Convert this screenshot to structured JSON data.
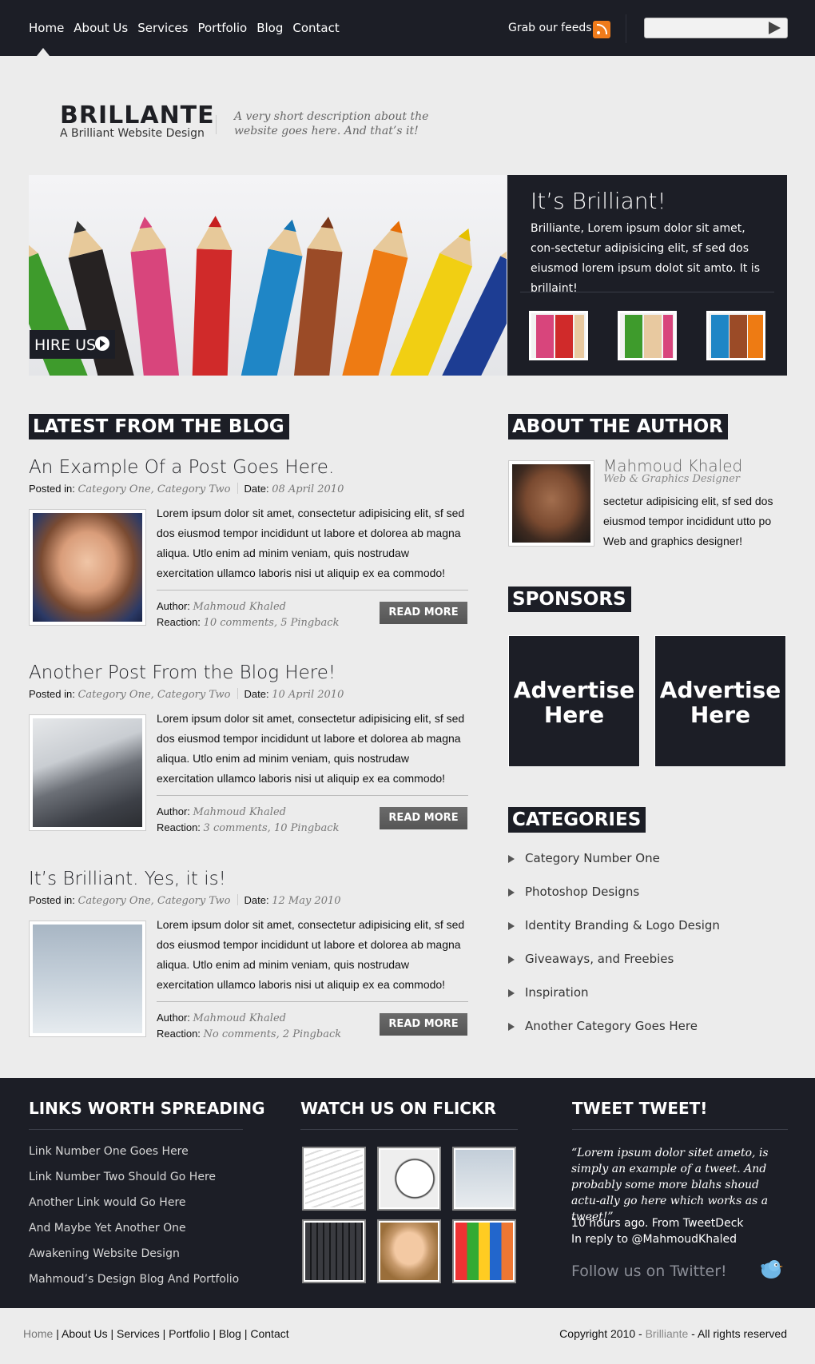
{
  "nav": {
    "items": [
      {
        "label": "Home"
      },
      {
        "label": "About Us"
      },
      {
        "label": "Services"
      },
      {
        "label": "Portfolio"
      },
      {
        "label": "Blog"
      },
      {
        "label": "Contact"
      }
    ],
    "feeds_label": "Grab our feeds",
    "search_placeholder": ""
  },
  "header": {
    "logo": "BRILLANTE",
    "logo_sub": "A Brilliant Website Design",
    "tagline": "A very short description about the website goes here. And that’s it!"
  },
  "hero": {
    "hire_label": "HIRE US",
    "side_title": "It’s Brilliant!",
    "side_text": "Brilliante, Lorem ipsum dolor sit amet, con-sectetur adipisicing elit, sf sed dos eiusmod lorem ipsum dolot sit amto. It is brillaint!"
  },
  "blog": {
    "heading": "LATEST FROM THE BLOG",
    "posted_in_label": "Posted in:",
    "date_label": "Date:",
    "author_label": "Author:",
    "reaction_label": "Reaction:",
    "readmore_label": "READ MORE",
    "posts": [
      {
        "title": "An Example Of a Post Goes Here.",
        "categories": "Category One, Category Two",
        "date": "08 April 2010",
        "body": "Lorem ipsum dolor sit amet, consectetur adipisicing elit, sf sed dos eiusmod tempor incididunt ut labore et dolorea ab magna aliqua. Utlo enim ad minim veniam, quis nostrudaw exercitation ullamco laboris nisi ut aliquip ex ea commodo!",
        "author": "Mahmoud Khaled",
        "reaction": "10 comments, 5 Pingback"
      },
      {
        "title": "Another Post From the Blog Here!",
        "categories": "Category One, Category Two",
        "date": "10 April 2010",
        "body": "Lorem ipsum dolor sit amet, consectetur adipisicing elit, sf sed dos eiusmod tempor incididunt ut labore et dolorea ab magna aliqua. Utlo enim ad minim veniam, quis nostrudaw exercitation ullamco laboris nisi ut aliquip ex ea commodo!",
        "author": "Mahmoud Khaled",
        "reaction": "3 comments, 10 Pingback"
      },
      {
        "title": "It’s Brilliant. Yes, it is!",
        "categories": "Category One, Category Two",
        "date": "12 May 2010",
        "body": "Lorem ipsum dolor sit amet, consectetur adipisicing elit, sf sed dos eiusmod tempor incididunt ut labore et dolorea ab magna aliqua. Utlo enim ad minim veniam, quis nostrudaw exercitation ullamco laboris nisi ut aliquip ex ea commodo!",
        "author": "Mahmoud Khaled",
        "reaction": "No comments, 2 Pingback"
      }
    ]
  },
  "author": {
    "heading": "ABOUT THE AUTHOR",
    "name": "Mahmoud Khaled",
    "role": "Web & Graphics Designer",
    "bio": "sectetur adipisicing elit, sf sed dos eiusmod tempor incididunt utto po Web and graphics designer!"
  },
  "sponsors": {
    "heading": "SPONSORS",
    "ad1": "Advertise Here",
    "ad2": "Advertise Here"
  },
  "categories": {
    "heading": "CATEGORIES",
    "items": [
      "Category Number One",
      "Photoshop Designs",
      "Identity Branding & Logo Design",
      "Giveaways, and Freebies",
      "Inspiration",
      "Another Category Goes Here"
    ]
  },
  "footer": {
    "links_heading": "LINKS WORTH SPREADING",
    "links": [
      "Link Number One Goes Here",
      "Link Number Two Should Go Here",
      "Another Link would Go Here",
      "And Maybe Yet Another One",
      "Awakening Website Design",
      "Mahmoud’s Design Blog And Portfolio"
    ],
    "flickr_heading": "WATCH US ON FLICKR",
    "tweet_heading": "TWEET TWEET!",
    "tweet_text": "“Lorem ipsum dolor sitet ameto, is simply an example of a tweet. And probably some more blahs shoud actu-ally go here which works as a tweet!”",
    "tweet_time": "10 hours ago. From TweetDeck",
    "tweet_reply": "In reply to @MahmoudKhaled",
    "follow_label": "Follow us on Twitter!"
  },
  "bottom": {
    "nav": [
      "Home",
      "About Us",
      "Services",
      "Portfolio",
      "Blog",
      "Contact"
    ],
    "copyright_pre": "Copyright 2010 - ",
    "copyright_brand": "Brilliante",
    "copyright_post": " - All rights reserved"
  },
  "colors": {
    "dark": "#1c1e26",
    "page_bg": "#ececec",
    "rss": "#ef7b1b",
    "button": "#606060"
  }
}
